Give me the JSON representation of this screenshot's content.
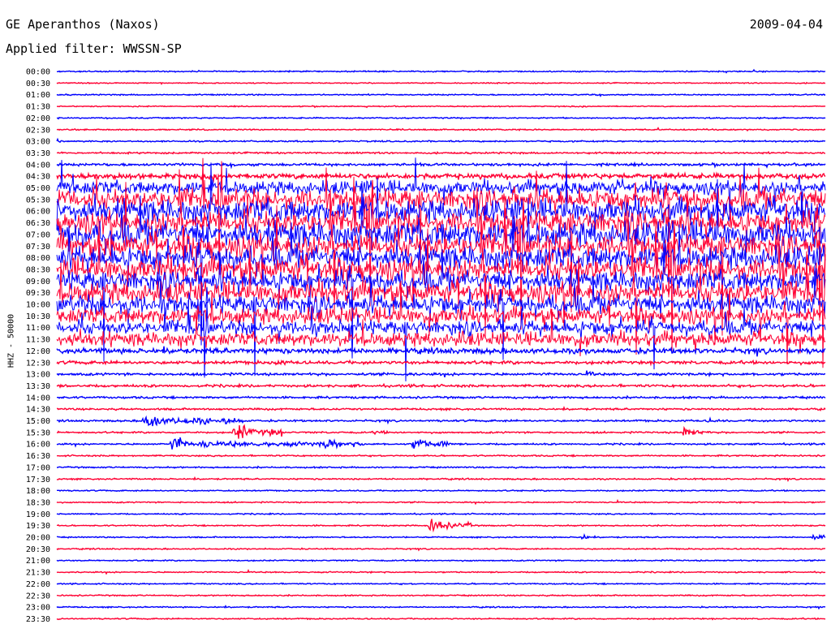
{
  "header": {
    "station": "GE Aperanthos (Naxos)",
    "date": "2009-04-04",
    "filter": "Applied filter: WWSSN-SP"
  },
  "colors": {
    "series_a": "#0000ff",
    "series_b": "#ff0033"
  },
  "chart_data": {
    "type": "line",
    "title": "GE Aperanthos (Naxos)",
    "subtitle": "Applied filter: WWSSN-SP",
    "date": "2009-04-04",
    "ylabel": "HHZ - 50000",
    "row_labels": [
      "00:00",
      "00:30",
      "01:00",
      "01:30",
      "02:00",
      "02:30",
      "03:00",
      "03:30",
      "04:00",
      "04:30",
      "05:00",
      "05:30",
      "06:00",
      "06:30",
      "07:00",
      "07:30",
      "08:00",
      "08:30",
      "09:00",
      "09:30",
      "10:00",
      "10:30",
      "11:00",
      "11:30",
      "12:00",
      "12:30",
      "13:00",
      "13:30",
      "14:00",
      "14:30",
      "15:00",
      "15:30",
      "16:00",
      "16:30",
      "17:00",
      "17:30",
      "18:00",
      "18:30",
      "19:00",
      "19:30",
      "20:00",
      "20:30",
      "21:00",
      "21:30",
      "22:00",
      "22:30",
      "23:00",
      "23:30"
    ],
    "row_colors": [
      "series_a",
      "series_b"
    ],
    "row_minutes": 30,
    "noise_level": [
      0.6,
      0.5,
      0.6,
      0.5,
      0.6,
      0.6,
      0.7,
      0.8,
      1.2,
      2.5,
      6,
      9,
      10,
      10,
      11,
      10,
      10,
      10,
      9,
      9,
      8,
      7,
      6,
      6,
      2.5,
      1.5,
      1.2,
      1.2,
      1.0,
      0.9,
      0.9,
      0.8,
      0.8,
      0.7,
      0.7,
      0.7,
      0.6,
      0.6,
      0.6,
      0.6,
      0.6,
      0.6,
      0.6,
      0.6,
      0.6,
      0.6,
      0.6,
      0.6
    ],
    "events": [
      {
        "row": "15:00",
        "minute": 3.5,
        "amplitude": 10,
        "duration": 2.5
      },
      {
        "row": "15:00",
        "minute": 6.5,
        "amplitude": 8,
        "duration": 0.8
      },
      {
        "row": "15:00",
        "minute": 25.5,
        "amplitude": 4,
        "duration": 0.6
      },
      {
        "row": "15:30",
        "minute": 7.0,
        "amplitude": 11,
        "duration": 1.8
      },
      {
        "row": "15:30",
        "minute": 12.5,
        "amplitude": 4,
        "duration": 0.5
      },
      {
        "row": "15:30",
        "minute": 24.5,
        "amplitude": 7,
        "duration": 1.0
      },
      {
        "row": "16:00",
        "minute": 4.5,
        "amplitude": 7,
        "duration": 6.0
      },
      {
        "row": "16:00",
        "minute": 10.5,
        "amplitude": 7,
        "duration": 1.5
      },
      {
        "row": "16:00",
        "minute": 14.0,
        "amplitude": 8,
        "duration": 1.2
      },
      {
        "row": "16:00",
        "minute": 15.0,
        "amplitude": 6,
        "duration": 0.6
      },
      {
        "row": "19:30",
        "minute": 14.6,
        "amplitude": 9,
        "duration": 1.6
      },
      {
        "row": "20:00",
        "minute": 20.5,
        "amplitude": 6,
        "duration": 0.3
      },
      {
        "row": "20:00",
        "minute": 29.6,
        "amplitude": 6,
        "duration": 0.4
      },
      {
        "row": "13:00",
        "minute": 13.8,
        "amplitude": 4,
        "duration": 0.4
      },
      {
        "row": "13:00",
        "minute": 20.8,
        "amplitude": 4,
        "duration": 0.6
      },
      {
        "row": "12:00",
        "minute": 20.8,
        "amplitude": 5,
        "duration": 1.0
      },
      {
        "row": "12:30",
        "minute": 8.5,
        "amplitude": 4,
        "duration": 2.0
      }
    ],
    "grid": false,
    "legend": "none"
  }
}
